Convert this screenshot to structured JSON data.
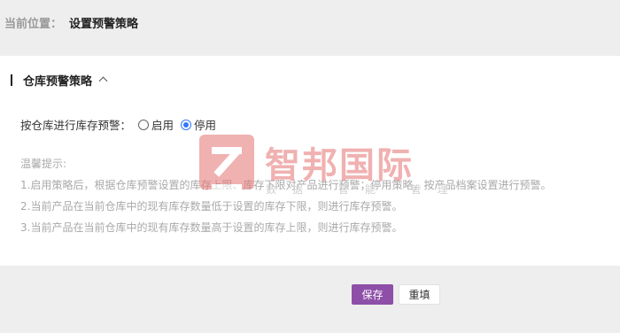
{
  "breadcrumb": {
    "label": "当前位置：",
    "current": "设置预警策略"
  },
  "section": {
    "title": "仓库预警策略",
    "expanded": true
  },
  "warning_setting": {
    "label": "按仓库进行库存预警：",
    "options": [
      {
        "label": "启用",
        "checked": false
      },
      {
        "label": "停用",
        "checked": true
      }
    ]
  },
  "tips": {
    "title": "温馨提示:",
    "lines": [
      "1.启用策略后，根据仓库预警设置的库存上限、库存下限对产品进行预警；停用策略，按产品档案设置进行预警。",
      "2.当前产品在当前仓库中的现有库存数量低于设置的库存下限，则进行库存预警。",
      "3.当前产品在当前仓库中的现有库存数量高于设置的库存上限，则进行库存预警。"
    ]
  },
  "watermark": {
    "text": "智邦国际",
    "subtext": "数据·智能·管理"
  },
  "buttons": {
    "save": "保存",
    "reset": "重填"
  },
  "colors": {
    "accent": "#8e4fa8",
    "radio": "#3478f6",
    "tip_text": "#a9a9a9"
  }
}
